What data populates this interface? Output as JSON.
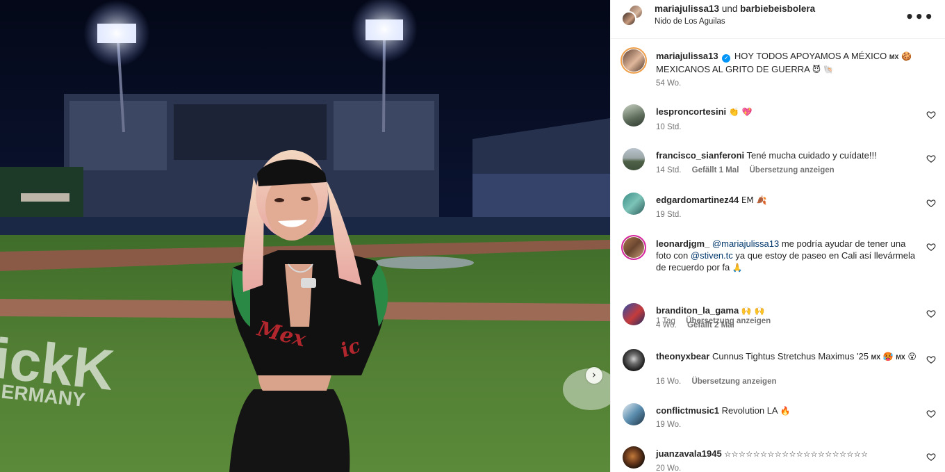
{
  "post_header": {
    "user1": "mariajulissa13",
    "connector": "und",
    "user2": "barbiebeisbolera",
    "location": "Nido de Los Aguilas",
    "more_icon": "more-horizontal-icon",
    "more_glyph": "•••"
  },
  "photo": {
    "description_icon": "stadium-photo",
    "next_glyph": "›"
  },
  "caption": {
    "username": "mariajulissa13",
    "verified_glyph": "✓",
    "text_line1": "HOY TODOS APOYAMOS A MÉXICO",
    "flag1": "MX",
    "emoji1": "🍪",
    "text_line2": "MEXICANOS AL GRITO DE GUERRA",
    "emoji2": "😈",
    "emoji3": "🐚",
    "time": "54 Wo."
  },
  "comments": [
    {
      "username": "lespron cortesini",
      "display_username": "lesproncortesini",
      "text": "👏 💖",
      "time": "10 Std."
    },
    {
      "username": "francisco_sianferoni",
      "text": "Tené mucha cuidado y cuídate!!!",
      "time": "14 Std.",
      "likes": "Gefällt 1 Mal",
      "translate": "Übersetzung anzeigen"
    },
    {
      "username": "edgardomartinez44",
      "text": "EM 🍂",
      "time": "19 Std."
    },
    {
      "username": "leonardjgm_",
      "mention1": "@mariajulissa13",
      "text1": "me podría ayudar de tener una foto con",
      "mention2": "@stiven.tc",
      "text2": "ya que estoy de paseo en Cali así llevármela de recuerdo por fa",
      "emoji": "🙏",
      "time": "1 Tag",
      "translate": "Übersetzung anzeigen"
    },
    {
      "username": "branditon_la_gama",
      "text": "🙌 🙌",
      "time": "4 Wo.",
      "likes": "Gefällt 2 Mal"
    },
    {
      "username": "theonyxbear",
      "text": "Cunnus Tightus Stretchus Maximus '25",
      "flag": "MX",
      "emoji": "🥵",
      "flag2": "MX",
      "emoji2": "😮",
      "time": "16 Wo.",
      "translate": "Übersetzung anzeigen"
    },
    {
      "username": "conflictmusic1",
      "text": "Revolution LA",
      "emoji": "🔥",
      "time": "19 Wo."
    },
    {
      "username": "juanzavala1945",
      "text": "☆☆☆☆☆☆☆☆☆☆☆☆☆☆☆☆☆☆☆☆",
      "time": "20 Wo."
    }
  ],
  "icons": {
    "heart": "heart-outline-icon",
    "verified": "verified-badge-icon"
  },
  "colors": {
    "text": "#262626",
    "meta": "#737373",
    "mention": "#00376b",
    "verified": "#0095f6",
    "story_ring": "#d6249f"
  }
}
